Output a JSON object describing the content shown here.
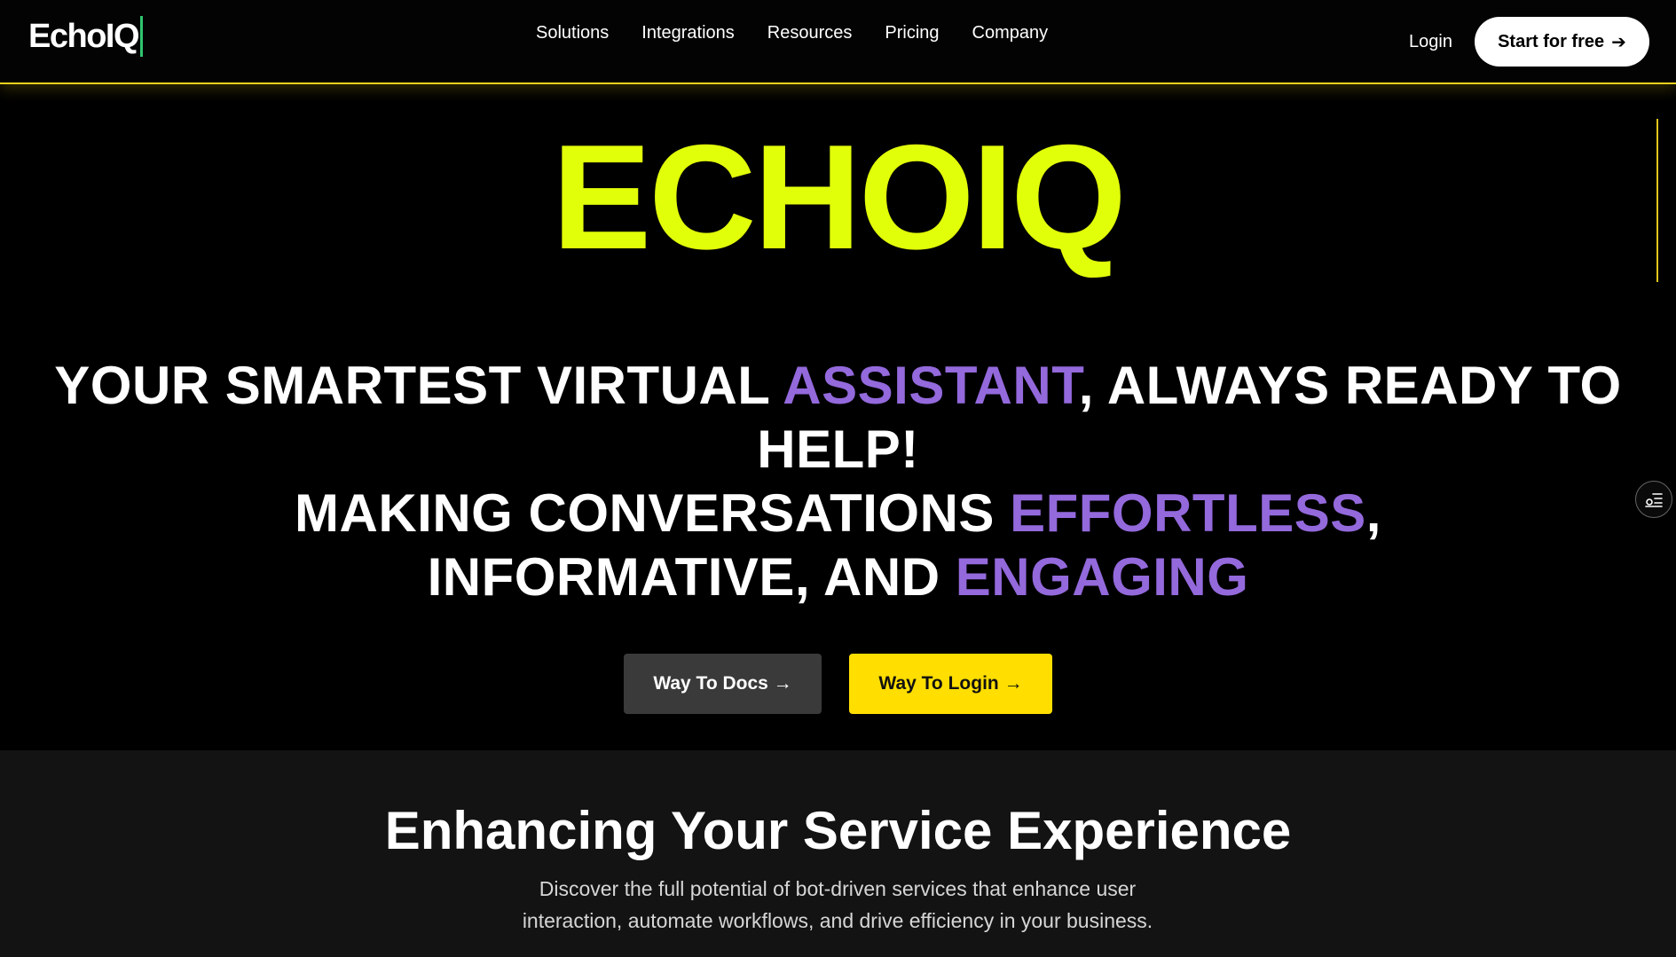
{
  "nav": {
    "logo": "EchoIQ",
    "links": [
      "Solutions",
      "Integrations",
      "Resources",
      "Pricing",
      "Company"
    ],
    "login": "Login",
    "cta": "Start for free",
    "cta_arrow": "➔"
  },
  "hero": {
    "title": "ECHOIQ",
    "line1_a": "YOUR SMARTEST VIRTUAL ",
    "line1_accent": "ASSISTANT",
    "line1_b": ", ALWAYS READY TO HELP!",
    "line2_a": "MAKING CONVERSATIONS ",
    "line2_accent": "EFFORTLESS",
    "line2_b": ",",
    "line3_a": "INFORMATIVE, AND ",
    "line3_accent": "ENGAGING",
    "btn_docs": "Way To Docs →",
    "btn_login": "Way To Login →"
  },
  "section": {
    "title": "Enhancing Your Service Experience",
    "desc_line1": "Discover the full potential of bot-driven services that enhance user",
    "desc_line2": "interaction, automate workflows, and drive efficiency in your business."
  },
  "colors": {
    "accent_yellow": "#e2ff0a",
    "accent_purple": "#9369dc",
    "button_yellow": "#ffde00",
    "nav_border": "#f2d21a"
  },
  "icons": {
    "floating": "settings-list-icon"
  }
}
